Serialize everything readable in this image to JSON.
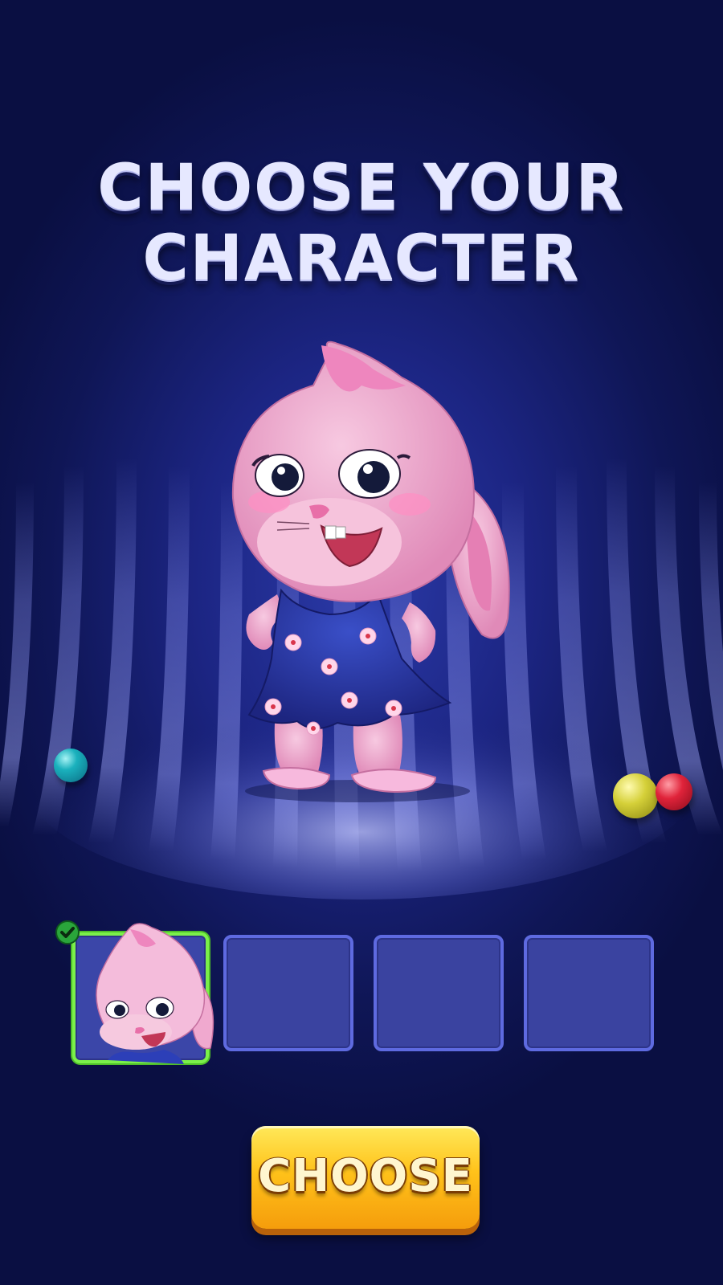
{
  "screen": {
    "title_line1": "CHOOSE YOUR",
    "title_line2": "CHARACTER"
  },
  "characters": [
    {
      "slot": 1,
      "name": "pink-bunny",
      "selected": true
    },
    {
      "slot": 2,
      "empty": true
    },
    {
      "slot": 3,
      "empty": true
    },
    {
      "slot": 4,
      "empty": true
    }
  ],
  "action": {
    "choose_label": "CHOOSE"
  },
  "colors": {
    "background": "#1c2583",
    "title_text": "#e6e8ff",
    "slot_fill": "#3a43a0",
    "slot_border": "#5e6ae0",
    "selected_border": "#7bf04a",
    "button_top": "#ffe95a",
    "button_bottom": "#f59d0c"
  },
  "icons": {
    "selected_indicator": "checkmark-icon"
  }
}
